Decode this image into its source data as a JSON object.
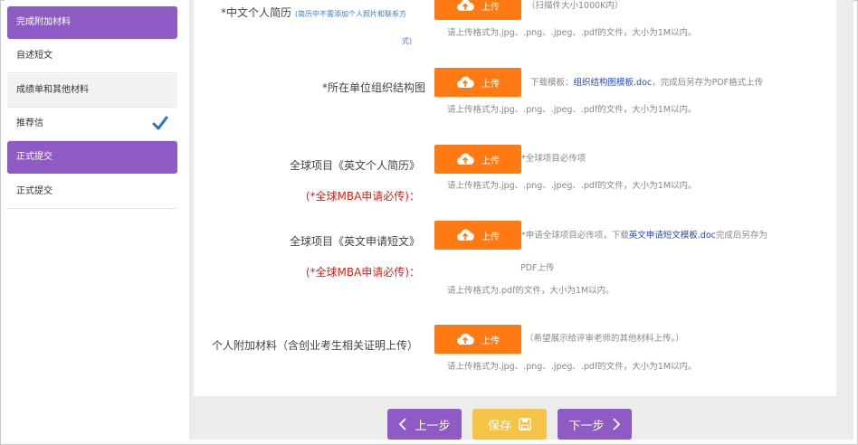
{
  "sidebar": {
    "items": [
      {
        "label": "完成附加材料"
      },
      {
        "label": "自述短文"
      },
      {
        "label": "成绩单和其他材料"
      },
      {
        "label": "推荐信"
      },
      {
        "label": "正式提交"
      },
      {
        "label": "正式提交"
      }
    ]
  },
  "fields": {
    "cv_cn": {
      "label": "*中文个人简历",
      "hint": "(简历中不需添加个人照片和联系方",
      "hint2": "式)",
      "button": "上传",
      "top_note": "（扫描件大小1000K内）",
      "format": "请上传格式为.jpg、.png、.jpeg、.pdf的文件，大小为1M以内。"
    },
    "org_chart": {
      "label": "*所在单位组织结构图",
      "button": "上传",
      "note_prefix": "下载模板：",
      "note_link": "组织结构图模板.doc",
      "note_suffix": "，完成后另存为PDF格式上传",
      "format": "请上传格式为.jpg、.png、.jpeg、.pdf的文件，大小为1M以内。"
    },
    "cv_en": {
      "label": "全球项目《英文个人简历》",
      "label2": "(*全球MBA申请必传)：",
      "button": "上传",
      "note": "*全球项目必传项",
      "format": "请上传格式为.jpg、.png、.jpeg、.pdf的文件，大小为1M以内。"
    },
    "essay_en": {
      "label": "全球项目《英文申请短文》",
      "label2": "(*全球MBA申请必传)：",
      "button": "上传",
      "note_prefix": "*申请全球项目必传项，下载",
      "note_link": "英文申请短文模板.doc",
      "note_suffix": "完成后另存为",
      "note_line2": "PDF上传",
      "format": "请上传格式为.pdf的文件，大小为1M以内。"
    },
    "extra": {
      "label": "个人附加材料（含创业考生相关证明上传）",
      "button": "上传",
      "note": "（希望展示给评审老师的其他材料上传。）",
      "format": "请上传格式为.jpg、.png、.jpeg、.pdf的文件，大小为1M以内。"
    }
  },
  "footer": {
    "prev": "上一步",
    "save": "保存",
    "next": "下一步"
  },
  "colors": {
    "accent_purple": "#8e5bc4",
    "upload_orange": "#ff7a12",
    "save_yellow": "#f5c447",
    "required_red": "#d9261c",
    "link_blue": "#2548c0"
  }
}
